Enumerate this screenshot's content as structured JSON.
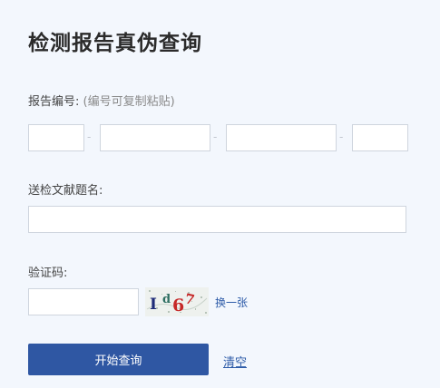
{
  "page": {
    "title": "检测报告真伪查询"
  },
  "report_no": {
    "label": "报告编号:",
    "hint": "(编号可复制粘贴)",
    "segments": [
      "",
      "",
      "",
      ""
    ],
    "separator": "-"
  },
  "sample_name": {
    "label": "送检文献题名:",
    "value": ""
  },
  "captcha": {
    "label": "验证码:",
    "value": "",
    "code": "Id67",
    "refresh_label": "换一张"
  },
  "actions": {
    "submit_label": "开始查询",
    "clear_label": "清空"
  },
  "colors": {
    "background": "#f3f7fd",
    "primary": "#2f57a3",
    "link": "#2d5ba8",
    "input_border": "#cfd5de"
  }
}
